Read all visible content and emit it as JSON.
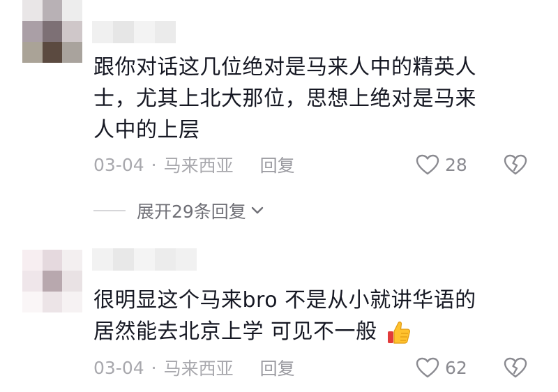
{
  "comments": [
    {
      "text_lines": [
        "跟你对话这几位绝对是马来人中的精英人",
        "士，尤其上北大那位，思想上绝对是马来",
        "人中的上层"
      ],
      "date": "03-04",
      "separator": "·",
      "location": "马来西亚",
      "reply_label": "回复",
      "likes": "28",
      "avatar_colors": [
        "#e9e6e7",
        "#b8b1b5",
        "#ededed",
        "#aa9fa6",
        "#7d7075",
        "#cfc7c9",
        "#aaa397",
        "#5b4a40",
        "#a9a39d"
      ]
    },
    {
      "text_lines": [
        "很明显这个马来bro 不是从小就讲华语的",
        "居然能去北京上学 可见不一般"
      ],
      "emoji": "thumbs-up",
      "date": "03-04",
      "separator": "·",
      "location": "马来西亚",
      "reply_label": "回复",
      "likes": "62",
      "avatar_colors": [
        "#f7eef1",
        "#e5d9de",
        "#f3eff0",
        "#efe6ea",
        "#b8a8ae",
        "#e9e2e4",
        "#faf6f7",
        "#ece4e7",
        "#f6f2f3"
      ]
    }
  ],
  "expand_replies_label": "展开29条回复",
  "icons": {
    "like": "heart-outline-icon",
    "dislike": "broken-heart-icon",
    "expand": "chevron-down-icon",
    "emoji": "thumbs-up-emoji"
  },
  "colors": {
    "text": "#161823",
    "meta": "#a8a8ad",
    "icon": "#8a8a90"
  }
}
